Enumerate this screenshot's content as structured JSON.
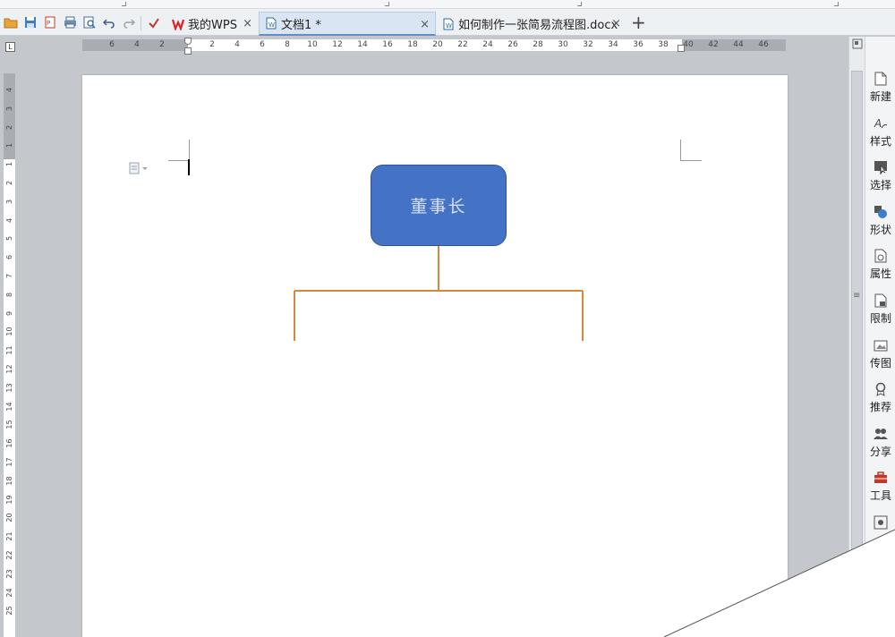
{
  "tabs": [
    {
      "label": "我的WPS",
      "active": false
    },
    {
      "label": "文档1 *",
      "active": true
    },
    {
      "label": "如何制作一张简易流程图.docx",
      "active": false
    }
  ],
  "new_tab_label": "+",
  "close_glyph": "×",
  "ruler_corner": "L",
  "hruler_numbers": [
    "6",
    "4",
    "2",
    "2",
    "4",
    "6",
    "8",
    "10",
    "12",
    "14",
    "16",
    "18",
    "20",
    "22",
    "24",
    "26",
    "28",
    "30",
    "32",
    "34",
    "36",
    "38",
    "40",
    "42",
    "44",
    "46"
  ],
  "vruler_numbers": [
    "4",
    "3",
    "2",
    "1",
    "1",
    "2",
    "3",
    "4",
    "5",
    "6",
    "7",
    "8",
    "9",
    "10",
    "11",
    "12",
    "13",
    "14",
    "15",
    "16",
    "17",
    "18",
    "19",
    "20",
    "21",
    "22",
    "23",
    "24",
    "25"
  ],
  "flowchart": {
    "root_label": "董事长",
    "box_color": "#4472c4",
    "box_border": "#2f5597",
    "connector_color": "#d48a3a"
  },
  "side_panel": [
    {
      "label": "新建",
      "icon": "new-doc-icon"
    },
    {
      "label": "样式",
      "icon": "style-icon"
    },
    {
      "label": "选择",
      "icon": "select-icon"
    },
    {
      "label": "形状",
      "icon": "shape-icon"
    },
    {
      "label": "属性",
      "icon": "property-icon"
    },
    {
      "label": "限制",
      "icon": "restrict-icon"
    },
    {
      "label": "传图",
      "icon": "upload-image-icon"
    },
    {
      "label": "推荐",
      "icon": "recommend-icon"
    },
    {
      "label": "分享",
      "icon": "share-icon"
    },
    {
      "label": "工具",
      "icon": "toolbox-icon"
    }
  ],
  "quick_access": [
    "open-folder-icon",
    "save-icon",
    "export-pdf-icon",
    "print-icon",
    "print-preview-icon",
    "undo-icon",
    "redo-icon",
    "customize-icon"
  ]
}
